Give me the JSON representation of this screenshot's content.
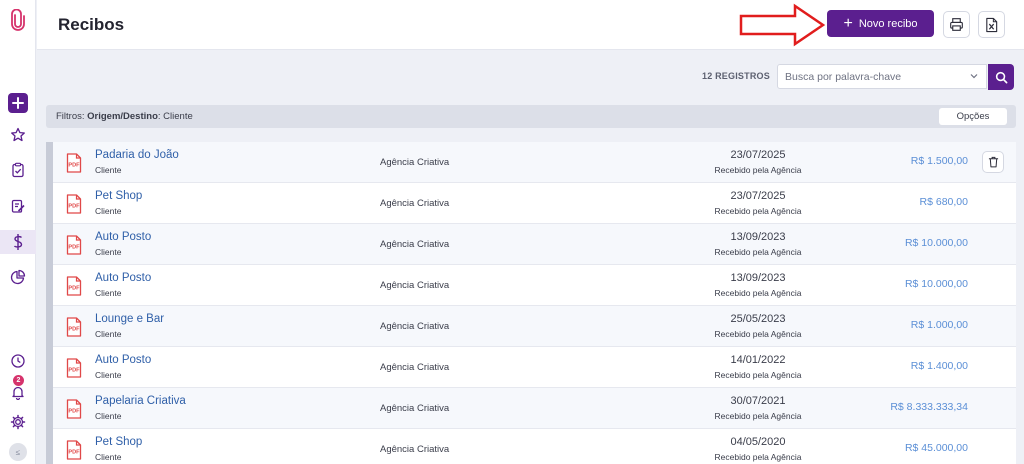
{
  "header": {
    "title": "Recibos",
    "new_button_label": "Novo recibo",
    "plus_glyph": "+"
  },
  "toolbar": {
    "record_count": "12 REGISTROS",
    "search_placeholder": "Busca por palavra-chave"
  },
  "filters": {
    "prefix": "Filtros:",
    "field": "Origem/Destino",
    "value": "Cliente",
    "options_label": "Opções"
  },
  "sidebar": {
    "notification_count": "2",
    "avatar_initial": "≤"
  },
  "rows": [
    {
      "name": "Padaria do João",
      "type": "Cliente",
      "agency": "Agência Criativa",
      "date": "23/07/2025",
      "status": "Recebido pela Agência",
      "value": "R$ 1.500,00"
    },
    {
      "name": "Pet Shop",
      "type": "Cliente",
      "agency": "Agência Criativa",
      "date": "23/07/2025",
      "status": "Recebido pela Agência",
      "value": "R$ 680,00"
    },
    {
      "name": "Auto Posto",
      "type": "Cliente",
      "agency": "Agência Criativa",
      "date": "13/09/2023",
      "status": "Recebido pela Agência",
      "value": "R$ 10.000,00"
    },
    {
      "name": "Auto Posto",
      "type": "Cliente",
      "agency": "Agência Criativa",
      "date": "13/09/2023",
      "status": "Recebido pela Agência",
      "value": "R$ 10.000,00"
    },
    {
      "name": "Lounge e Bar",
      "type": "Cliente",
      "agency": "Agência Criativa",
      "date": "25/05/2023",
      "status": "Recebido pela Agência",
      "value": "R$ 1.000,00"
    },
    {
      "name": "Auto Posto",
      "type": "Cliente",
      "agency": "Agência Criativa",
      "date": "14/01/2022",
      "status": "Recebido pela Agência",
      "value": "R$ 1.400,00"
    },
    {
      "name": "Papelaria Criativa",
      "type": "Cliente",
      "agency": "Agência Criativa",
      "date": "30/07/2021",
      "status": "Recebido pela Agência",
      "value": "R$ 8.333.333,34"
    },
    {
      "name": "Pet Shop",
      "type": "Cliente",
      "agency": "Agência Criativa",
      "date": "04/05/2020",
      "status": "Recebido pela Agência",
      "value": "R$ 45.000,00"
    }
  ],
  "icons": {
    "pdf_label": "PDF"
  },
  "colors": {
    "accent": "#5b1f8f",
    "link": "#2f5fa8",
    "value": "#5b8fd6",
    "arrow": "#e11d1d"
  }
}
